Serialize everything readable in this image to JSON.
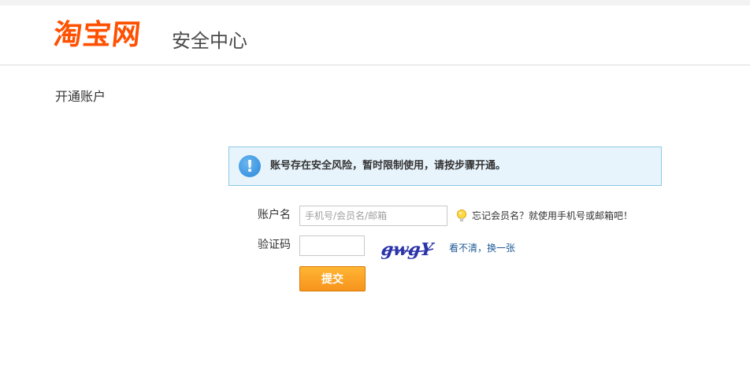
{
  "header": {
    "logo_text": "淘宝网",
    "section_title": "安全中心"
  },
  "page": {
    "heading": "开通账户"
  },
  "notice": {
    "icon": "exclamation-icon",
    "text": "账号存在安全风险，暂时限制使用，请按步骤开通。"
  },
  "form": {
    "account_label": "账户名",
    "account_placeholder": "手机号/会员名/邮箱",
    "account_value": "",
    "hint_icon": "lightbulb-icon",
    "hint_text": "忘记会员名？就使用手机号或邮箱吧！",
    "captcha_label": "验证码",
    "captcha_value": "",
    "captcha_image_text": "gwgY",
    "refresh_text_1": "看不清",
    "refresh_separator": "，",
    "refresh_text_2": "换一张",
    "submit_label": "提交"
  },
  "colors": {
    "brand": "#ff5000",
    "notice_bg": "#e8f4fc",
    "notice_border": "#8cc8e6",
    "link": "#1f5a96",
    "button": "#f7941d"
  }
}
